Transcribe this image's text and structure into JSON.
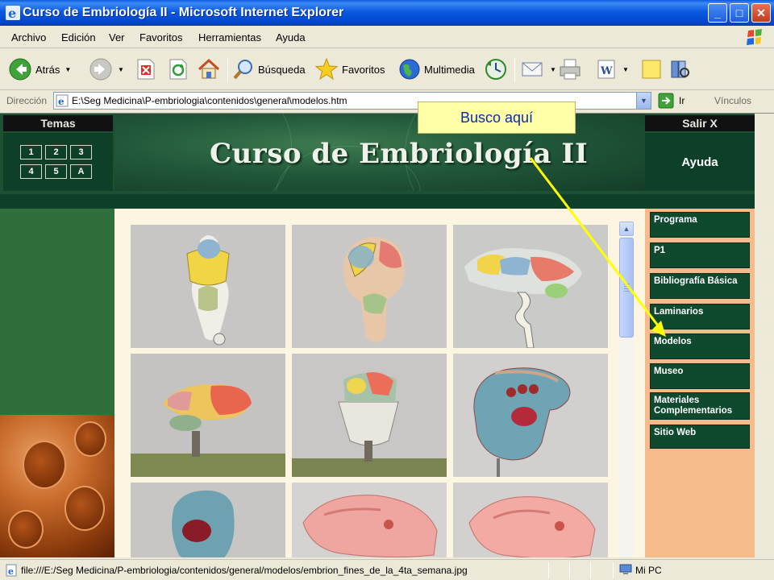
{
  "window": {
    "title": "Curso de Embriología II - Microsoft Internet Explorer",
    "buttons": {
      "minimize": "_",
      "maximize": "□",
      "close": "✕"
    }
  },
  "menu": [
    "Archivo",
    "Edición",
    "Ver",
    "Favoritos",
    "Herramientas",
    "Ayuda"
  ],
  "toolbar": {
    "back": "Atrás",
    "search": "Búsqueda",
    "favorites": "Favoritos",
    "media": "Multimedia"
  },
  "address": {
    "label": "Dirección",
    "url": "E:\\Seg Medicina\\P-embriologia\\contenidos\\general\\modelos.htm",
    "go": "Ir",
    "links": "Vínculos"
  },
  "site": {
    "temas_label": "Temas",
    "salir_label": "Salir X",
    "title": "Curso de Embriología II",
    "ayuda_label": "Ayuda",
    "topic_buttons": [
      "1",
      "2",
      "3",
      "4",
      "5",
      "A"
    ],
    "nav": [
      "Programa",
      "P1",
      "Bibliografía Básica",
      "Laminarios",
      "Modelos",
      "Museo",
      "Materiales Complementarios",
      "Sitio Web"
    ]
  },
  "annotation": {
    "text": "Busco aquí",
    "color": "#ffff00"
  },
  "status": {
    "text": "file:///E:/Seg Medicina/P-embriologia/contenidos/general/modelos/embrion_fines_de_la_4ta_semana.jpg",
    "zone": "Mi PC"
  },
  "colors": {
    "xp_blue": "#0a5ae0",
    "site_green": "#1d5134",
    "nav_green": "#0f4a2f",
    "nav_bg": "#f6bb8a",
    "content_bg": "#fcf5e2"
  }
}
